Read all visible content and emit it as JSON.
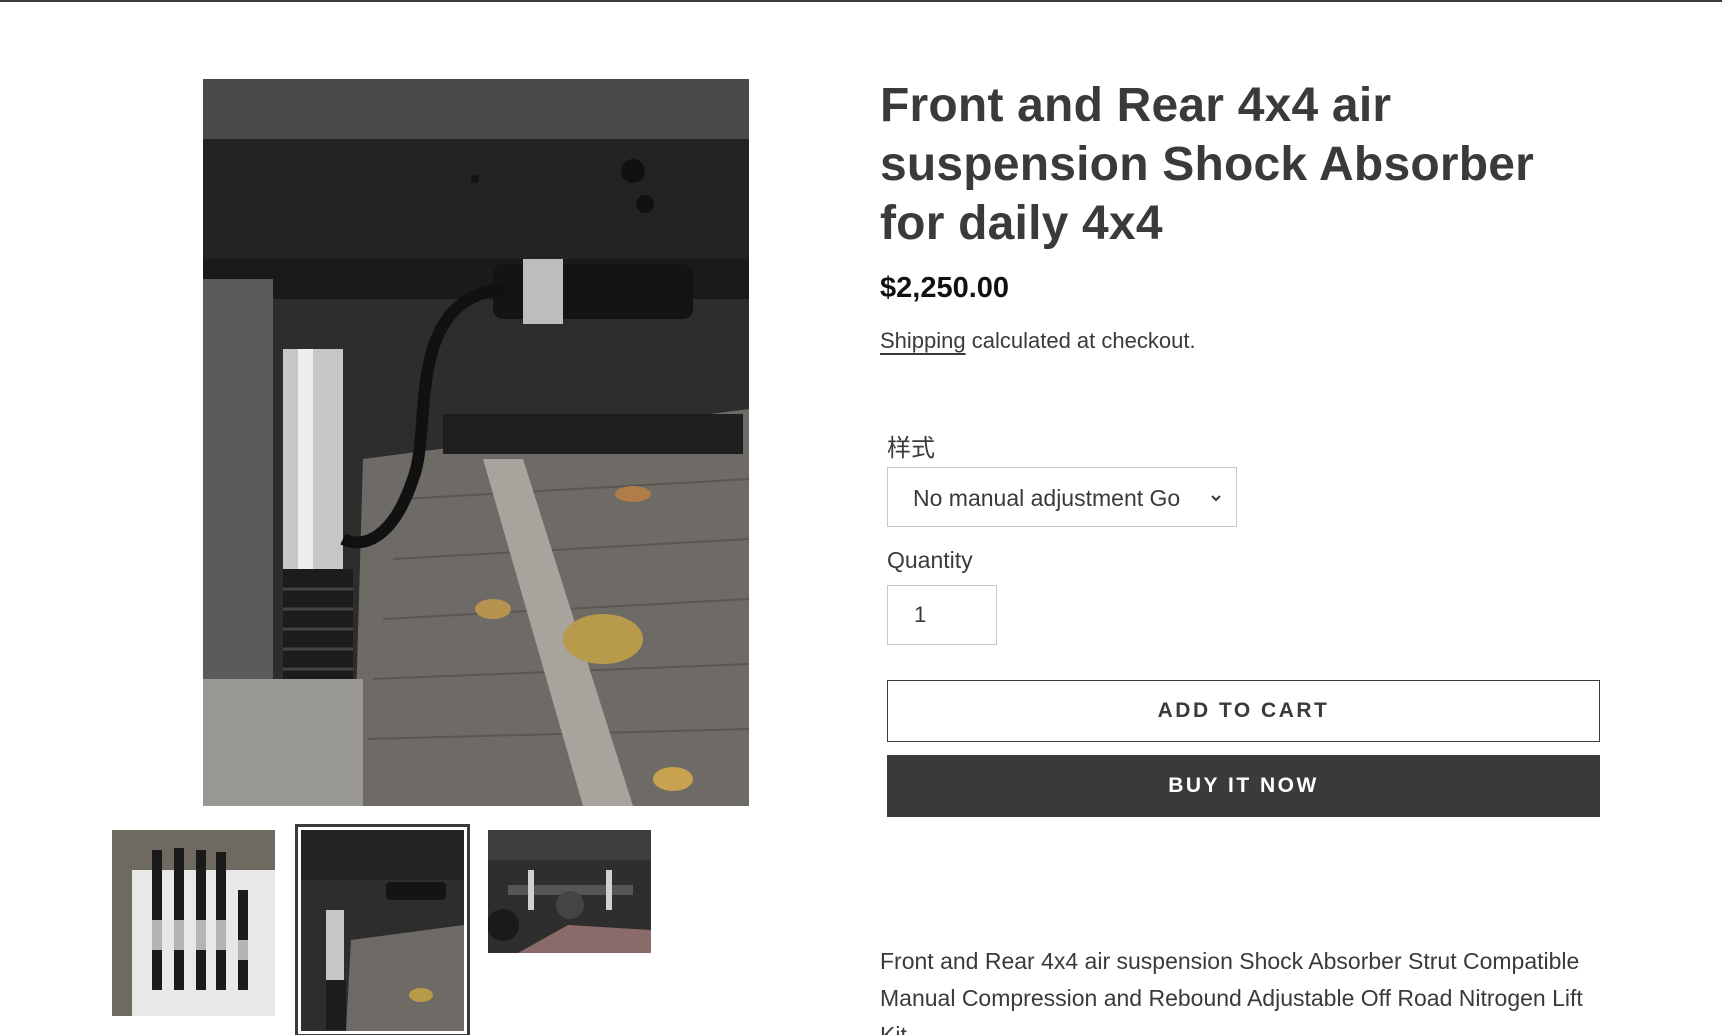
{
  "product": {
    "title": "Front and Rear 4x4 air suspension Shock Absorber for daily 4x4",
    "price": "$2,250.00",
    "shipping_link": "Shipping",
    "shipping_suffix": " calculated at checkout.",
    "variant_label": "样式",
    "variant_selected": "No manual adjustment Go",
    "quantity_label": "Quantity",
    "quantity_value": "1",
    "add_to_cart": "ADD TO CART",
    "buy_now": "BUY IT NOW",
    "description": "Front and Rear 4x4 air suspension Shock Absorber Strut Compatible Manual Compression and Rebound Adjustable Off Road Nitrogen Lift Kit"
  },
  "gallery": {
    "selected_index": 1,
    "thumbnail_count": 3
  },
  "icons": {
    "select_arrow": "chevron-down-icon"
  },
  "colors": {
    "text": "#3a3a3a",
    "button_dark": "#3a3a3a",
    "border": "#c9c9c9"
  }
}
